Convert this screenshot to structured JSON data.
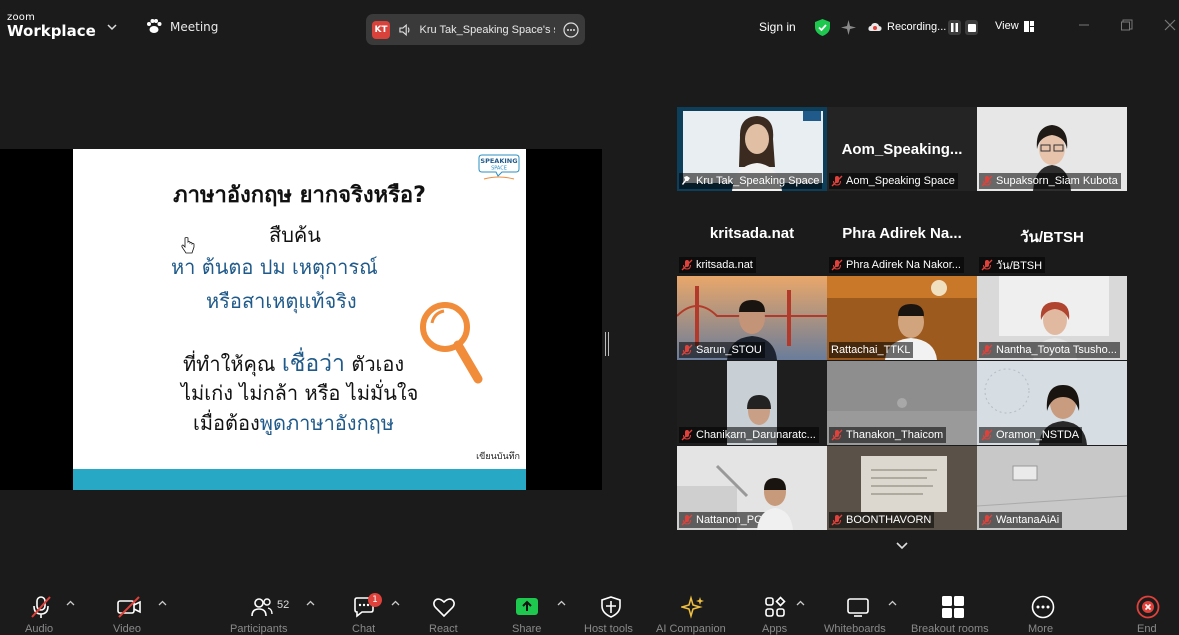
{
  "app": {
    "logo_line1": "zoom",
    "logo_line2": "Workplace",
    "meeting_label": "Meeting",
    "sign_in": "Sign in",
    "recording_label": "Recording...",
    "view_label": "View"
  },
  "share_pill": {
    "initials": "KT",
    "text": "Kru Tak_Speaking Space's sc"
  },
  "slide": {
    "title": "ภาษาอังกฤษ ยากจริงหรือ?",
    "line1": "สืบค้น",
    "line2": "หา ต้นตอ ปม เหตุการณ์",
    "line3": "หรือสาเหตุแท้จริง",
    "line4a": "ที่ทำให้คุณ ",
    "line4b": "เชื่อว่า",
    "line4c": " ตัวเอง",
    "line5": "ไม่เก่ง  ไม่กล้า หรือ ไม่มั่นใจ",
    "line6a": "เมื่อต้อง",
    "line6b": "พูดภาษาอังกฤษ",
    "footer": "เขียนบันทึก",
    "logo_text1": "SPEAKING",
    "logo_text2": "SPACE"
  },
  "participants": [
    {
      "name": "Kru Tak_Speaking Space",
      "big": "",
      "active": true
    },
    {
      "name": "Aom_Speaking Space",
      "big": "Aom_Speaking..."
    },
    {
      "name": "Supaksorn_Siam Kubota",
      "big": ""
    },
    {
      "name": "kritsada.nat",
      "big": "kritsada.nat"
    },
    {
      "name": "Phra Adirek Na Nakor...",
      "big": "Phra  Adirek  Na..."
    },
    {
      "name": "วัน/BTSH",
      "big": "วัน/BTSH"
    },
    {
      "name": "Sarun_STOU",
      "big": ""
    },
    {
      "name": "Rattachai_TTKL",
      "big": ""
    },
    {
      "name": "Nantha_Toyota Tsusho...",
      "big": ""
    },
    {
      "name": "Chanikarn_Darunaratc...",
      "big": ""
    },
    {
      "name": "Thanakon_Thaicom",
      "big": ""
    },
    {
      "name": "Oramon_NSTDA",
      "big": ""
    },
    {
      "name": "Nattanon_PCC",
      "big": ""
    },
    {
      "name": "BOONTHAVORN",
      "big": ""
    },
    {
      "name": "WantanaAiAi",
      "big": ""
    }
  ],
  "toolbar": {
    "audio": "Audio",
    "video": "Video",
    "participants": "Participants",
    "participants_count": "52",
    "chat": "Chat",
    "chat_badge": "1",
    "react": "React",
    "share": "Share",
    "host_tools": "Host tools",
    "ai_companion": "AI Companion",
    "apps": "Apps",
    "whiteboards": "Whiteboards",
    "breakout_rooms": "Breakout rooms",
    "more": "More",
    "end": "End"
  },
  "colors": {
    "accent_green": "#4cd964",
    "share_green": "#1ec84f",
    "slide_bar": "#27a9c5",
    "slide_blue": "#1f5a8a",
    "mute_red": "#e0413a",
    "magnifier_orange": "#f08c3a"
  }
}
